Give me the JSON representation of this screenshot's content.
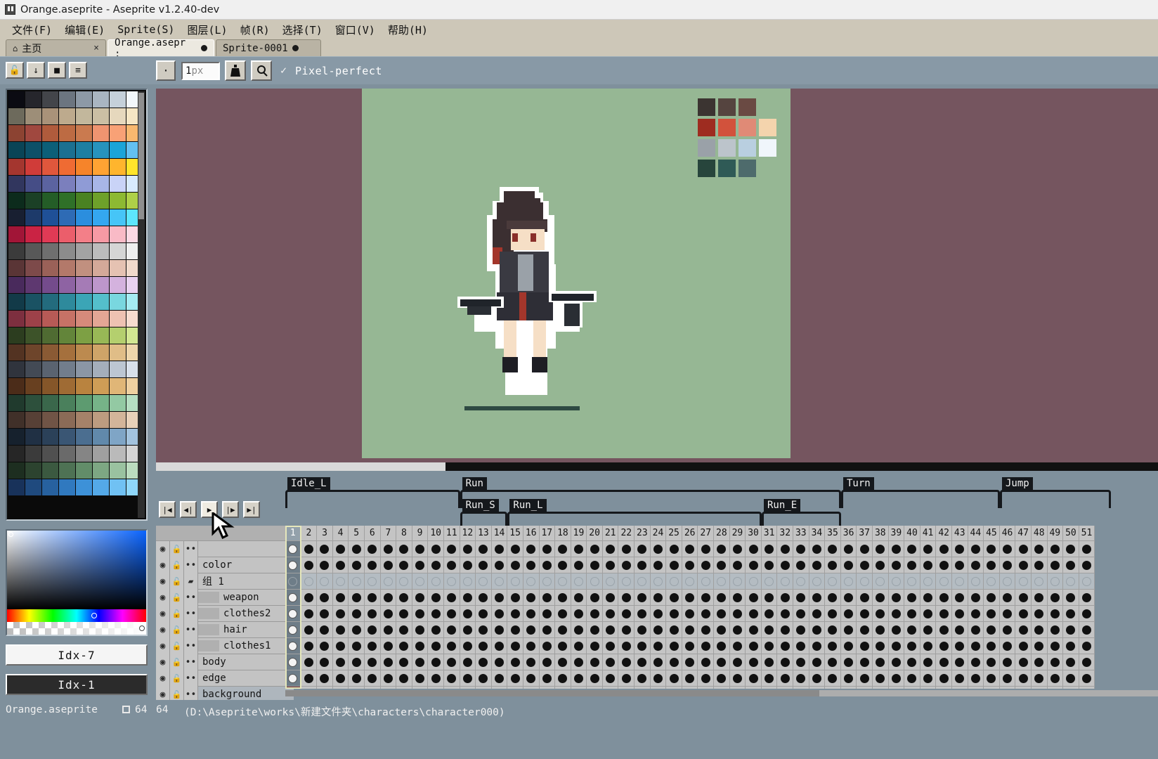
{
  "window": {
    "title": "Orange.aseprite - Aseprite v1.2.40-dev",
    "app_icon": "aseprite-icon"
  },
  "menubar": {
    "items": [
      {
        "label": "文件(F)"
      },
      {
        "label": "编辑(E)"
      },
      {
        "label": "Sprite(S)"
      },
      {
        "label": "图层(L)"
      },
      {
        "label": "帧(R)"
      },
      {
        "label": "选择(T)"
      },
      {
        "label": "窗口(V)"
      },
      {
        "label": "帮助(H)"
      }
    ]
  },
  "tabs": [
    {
      "label": "主页",
      "state": "inactive",
      "close": "×",
      "icon": "home-icon"
    },
    {
      "label": "Orange.asepr :",
      "state": "active",
      "modified_dot": true
    },
    {
      "label": "Sprite-0001",
      "state": "inactive",
      "modified_dot": true
    }
  ],
  "toolbar": {
    "lock_label": "🔓",
    "down_label": "↓",
    "square_label": "■",
    "menu_label": "≡",
    "dot_label": "·",
    "brush_size_value": "1",
    "brush_size_unit": "px",
    "ink_label": "ink-icon",
    "pixel_perfect_label": "Pixel-perfect",
    "pixel_perfect_check": "✓"
  },
  "palette": {
    "colors": [
      [
        "#0b0b12",
        "#26262c",
        "#43454a",
        "#6c7580",
        "#8d99a6",
        "#a9b5c1",
        "#c5d0da",
        "#f2f7fb"
      ],
      [
        "#6d6a5c",
        "#9d8e78",
        "#a99279",
        "#bdaa8d",
        "#c2b79c",
        "#cbbfa4",
        "#e6d8bd",
        "#f6e6c4"
      ],
      [
        "#8c4332",
        "#a0483f",
        "#b05b3c",
        "#bd6b43",
        "#ca7a4f",
        "#ef9470",
        "#f8a176",
        "#f8b86f"
      ],
      [
        "#0a4456",
        "#0d5068",
        "#0c5f78",
        "#1b7091",
        "#1d7fa2",
        "#2793bd",
        "#1ba4d8",
        "#63c0f0"
      ],
      [
        "#a4362f",
        "#d03c39",
        "#e0573c",
        "#ef6b33",
        "#f6842a",
        "#ffa333",
        "#ffb52d",
        "#ffe52b"
      ],
      [
        "#31365e",
        "#454d86",
        "#5b63a0",
        "#7b7fbd",
        "#8f9bd6",
        "#a8b6e7",
        "#c9d3f7",
        "#d8eafd"
      ],
      [
        "#0c2b1c",
        "#1b4026",
        "#245d27",
        "#2f7028",
        "#4a8222",
        "#6ea12a",
        "#8db932",
        "#aed048"
      ],
      [
        "#181f31",
        "#1d3a6a",
        "#1f5097",
        "#2e6bb5",
        "#2b8ede",
        "#34a7f0",
        "#46c5f7",
        "#5de6fd"
      ],
      [
        "#a11537",
        "#ca2344",
        "#e03a55",
        "#eb5e6b",
        "#f37f88",
        "#f69aa4",
        "#f9bac6",
        "#fcd9e4"
      ],
      [
        "#3b3b3b",
        "#585858",
        "#6f6f6f",
        "#8c8c8c",
        "#a3a3a3",
        "#bcbcbc",
        "#d5d5d5",
        "#efefef"
      ],
      [
        "#5a3536",
        "#7d4a4a",
        "#9a6158",
        "#b3796a",
        "#c1907f",
        "#d4a999",
        "#e5c2b2",
        "#f1dacb"
      ],
      [
        "#492a5c",
        "#5e3870",
        "#744b8c",
        "#8e63a3",
        "#a57bb6",
        "#bd96cb",
        "#d4b2de",
        "#e9d2f0"
      ],
      [
        "#123a48",
        "#1a5263",
        "#236b7d",
        "#2e8a9c",
        "#3ba5b6",
        "#54bfcb",
        "#79d7df",
        "#a5ecf2"
      ],
      [
        "#7d2f3f",
        "#9d4149",
        "#b75a56",
        "#c77266",
        "#d68a7b",
        "#e3a695",
        "#eec2b2",
        "#f7dccf"
      ],
      [
        "#2c3d1f",
        "#3d5329",
        "#4f6b32",
        "#63853a",
        "#7da044",
        "#98b856",
        "#b4cf6e",
        "#d2e792"
      ],
      [
        "#533322",
        "#6e452b",
        "#8a5a34",
        "#a5703d",
        "#bc8a4f",
        "#cfa468",
        "#e0bd87",
        "#eed6ab"
      ],
      [
        "#30343d",
        "#434a55",
        "#5a6370",
        "#727d8c",
        "#8b96a5",
        "#a4aebb",
        "#bcc6d2",
        "#d8e0ea"
      ],
      [
        "#4b2c19",
        "#684020",
        "#855629",
        "#9f6b34",
        "#b9833f",
        "#cf9d56",
        "#e0b677",
        "#eed0a0"
      ],
      [
        "#203a2d",
        "#2d503c",
        "#3a674b",
        "#4a805c",
        "#5d9b70",
        "#76b388",
        "#93c9a3",
        "#b6dec2"
      ],
      [
        "#403029",
        "#574036",
        "#705446",
        "#8b6b57",
        "#a58269",
        "#bc9c80",
        "#d3b59a",
        "#e8d1b9"
      ],
      [
        "#16212d",
        "#203044",
        "#2b4159",
        "#3a5674",
        "#4b6e90",
        "#6189ab",
        "#7fa5c6",
        "#a3c3de"
      ],
      [
        "#262626",
        "#3b3b3b",
        "#505050",
        "#6a6a6a",
        "#858585",
        "#a0a0a0",
        "#bababa",
        "#d5d5d5"
      ],
      [
        "#1d2e20",
        "#2c432f",
        "#3b5940",
        "#4e7254",
        "#628d69",
        "#7da783",
        "#9ac2a0",
        "#bbdcbf"
      ],
      [
        "#18325a",
        "#1f4a7e",
        "#27619f",
        "#3079bf",
        "#3d91d8",
        "#54a9e8",
        "#70c1f3",
        "#8fd7fa"
      ]
    ],
    "selected_index_fg": "Idx-7",
    "selected_index_bg": "Idx-1"
  },
  "canvas": {
    "bg_color": "#75555f",
    "sprite_bg_color": "#96b794",
    "palette_swatches": [
      [
        "#3b3431",
        "#55443f",
        "#6a4a43"
      ],
      [
        "#9e2c20",
        "#d2523c",
        "#e08a76",
        "#f4d4ad"
      ],
      [
        "#9aa1a8",
        "#bcc4cb",
        "#b9cfe0",
        "#f0f6fb"
      ],
      [
        "#27453c",
        "#2f5a56",
        "#4e6b6c"
      ]
    ],
    "ground_color": "#2e4a42"
  },
  "timeline": {
    "nav_buttons": [
      {
        "label": "|◀",
        "name": "go-first-frame"
      },
      {
        "label": "◀|",
        "name": "go-prev-frame"
      },
      {
        "label": "▶",
        "name": "play-animation"
      },
      {
        "label": "|▶",
        "name": "go-next-frame"
      },
      {
        "label": "▶|",
        "name": "go-last-frame"
      }
    ],
    "tags_row1": [
      {
        "label": "Idle_L",
        "start": 1,
        "end": 11
      },
      {
        "label": "Run",
        "start": 12,
        "end": 35
      },
      {
        "label": "Turn",
        "start": 36,
        "end": 45
      },
      {
        "label": "Jump",
        "start": 46,
        "end": 52
      }
    ],
    "tags_row2": [
      {
        "label": "Run_S",
        "start": 12,
        "end": 14
      },
      {
        "label": "Run_L",
        "start": 15,
        "end": 30
      },
      {
        "label": "Run_E",
        "start": 31,
        "end": 35
      }
    ],
    "frame_numbers": [
      1,
      2,
      3,
      4,
      5,
      6,
      7,
      8,
      9,
      10,
      11,
      12,
      13,
      14,
      15,
      16,
      17,
      18,
      19,
      20,
      21,
      22,
      23,
      24,
      25,
      26,
      27,
      28,
      29,
      30,
      31,
      32,
      33,
      34,
      35,
      36,
      37,
      38,
      39,
      40,
      41,
      42,
      43,
      44,
      45,
      46,
      47,
      48,
      49,
      50,
      51
    ],
    "current_frame": 1,
    "layers": [
      {
        "name": "",
        "visible": true,
        "locked": true,
        "linked": true,
        "type": "layer",
        "indent": 0,
        "cell_style": "key"
      },
      {
        "name": "color",
        "visible": true,
        "locked": true,
        "linked": true,
        "type": "layer",
        "indent": 0,
        "cell_style": "key"
      },
      {
        "name": "组 1",
        "visible": true,
        "locked": true,
        "linked": false,
        "type": "group",
        "indent": 0,
        "cell_style": "empty"
      },
      {
        "name": "weapon",
        "visible": true,
        "locked": true,
        "linked": true,
        "type": "layer",
        "indent": 1,
        "cell_style": "key"
      },
      {
        "name": "clothes2",
        "visible": true,
        "locked": true,
        "linked": true,
        "type": "layer",
        "indent": 1,
        "cell_style": "key"
      },
      {
        "name": "hair",
        "visible": true,
        "locked": true,
        "linked": true,
        "type": "layer",
        "indent": 1,
        "cell_style": "key"
      },
      {
        "name": "clothes1",
        "visible": true,
        "locked": true,
        "linked": true,
        "type": "layer",
        "indent": 1,
        "cell_style": "key"
      },
      {
        "name": "body",
        "visible": true,
        "locked": true,
        "linked": true,
        "type": "layer",
        "indent": 0,
        "cell_style": "key"
      },
      {
        "name": "edge",
        "visible": true,
        "locked": true,
        "linked": true,
        "type": "layer",
        "indent": 0,
        "cell_style": "key"
      },
      {
        "name": "background",
        "visible": true,
        "locked": true,
        "linked": true,
        "type": "layer",
        "indent": 0,
        "cell_style": "white",
        "selected": true
      }
    ],
    "icons": {
      "eye": "👁",
      "lock": "🔒",
      "link": "••",
      "folder": "📁"
    }
  },
  "statusbar": {
    "filename": "Orange.aseprite",
    "size_w": "64",
    "size_h": "64",
    "path": "(D:\\Aseprite\\works\\新建文件夹\\characters\\character000)"
  }
}
